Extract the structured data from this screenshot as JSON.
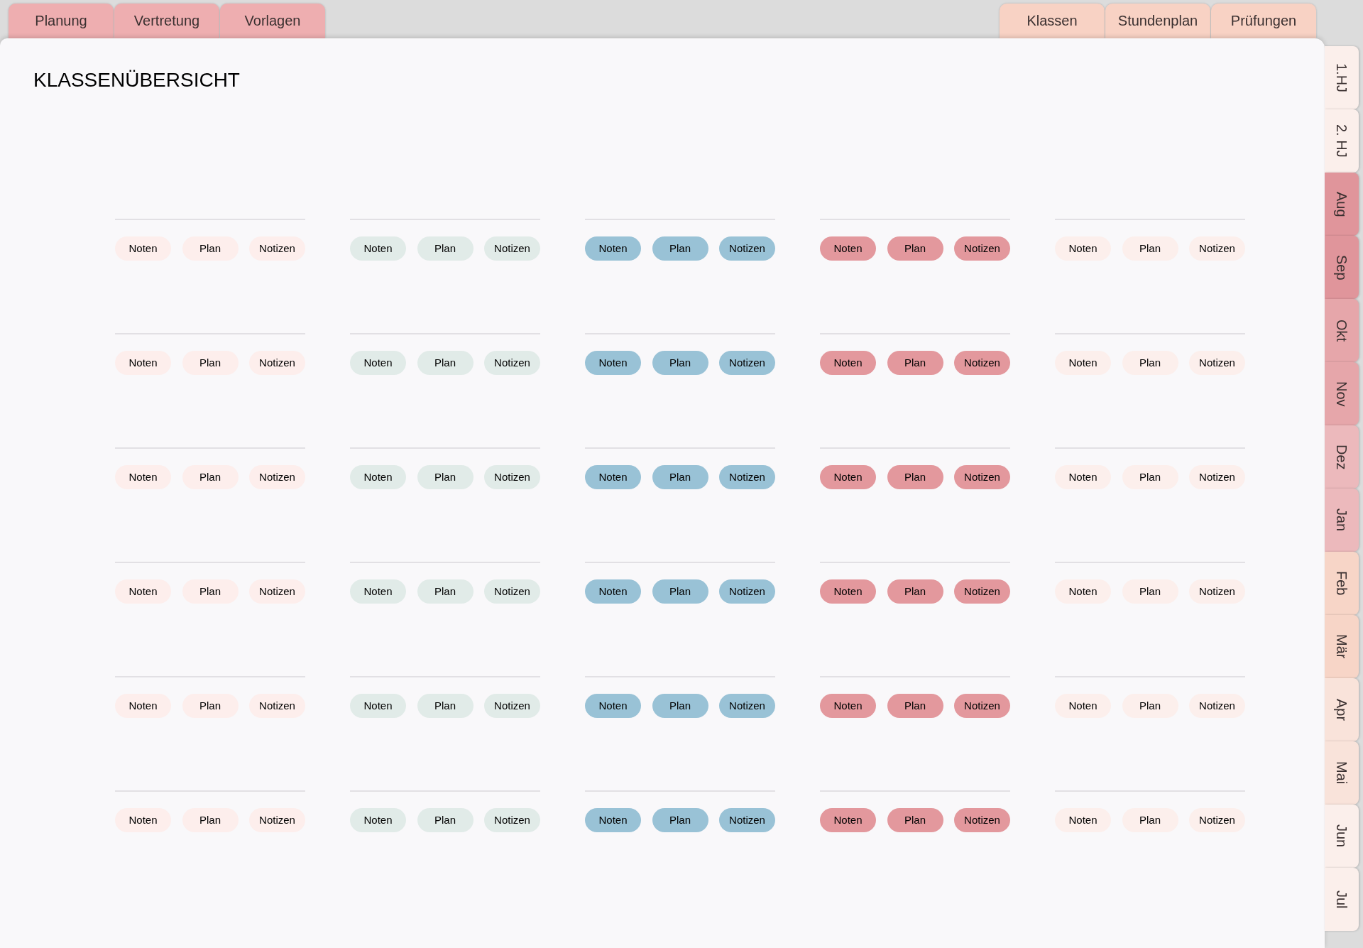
{
  "top_tabs_left": [
    {
      "label": "Planung",
      "color": "#eeaeb0"
    },
    {
      "label": "Vertretung",
      "color": "#eeaeb0"
    },
    {
      "label": "Vorlagen",
      "color": "#eeaeb0"
    }
  ],
  "top_tabs_right": [
    {
      "label": "Klassen",
      "color": "#f8d2c4"
    },
    {
      "label": "Stundenplan",
      "color": "#f8d2c4"
    },
    {
      "label": "Prüfungen",
      "color": "#f8d2c4"
    }
  ],
  "title": "KLASSENÜBERSICHT",
  "side_tabs": [
    {
      "label": "1.HJ",
      "color": "#fbefeb"
    },
    {
      "label": "2. HJ",
      "color": "#fbefeb"
    },
    {
      "label": "Aug",
      "color": "#e0959b"
    },
    {
      "label": "Sep",
      "color": "#e0959b"
    },
    {
      "label": "Okt",
      "color": "#e6a6aa"
    },
    {
      "label": "Nov",
      "color": "#e6a6aa"
    },
    {
      "label": "Dez",
      "color": "#ecb9bc"
    },
    {
      "label": "Jan",
      "color": "#ecb9bc"
    },
    {
      "label": "Feb",
      "color": "#f7d5c7"
    },
    {
      "label": "Mär",
      "color": "#f7d5c7"
    },
    {
      "label": "Apr",
      "color": "#f9e3da"
    },
    {
      "label": "Mai",
      "color": "#f9e3da"
    },
    {
      "label": "Jun",
      "color": "#fbefeb"
    },
    {
      "label": "Jul",
      "color": "#fbefeb"
    }
  ],
  "class_columns": [
    {
      "color": "#fdeeec",
      "cards": [
        [
          "Noten",
          "Plan",
          "Notizen"
        ],
        [
          "Noten",
          "Plan",
          "Notizen"
        ],
        [
          "Noten",
          "Plan",
          "Notizen"
        ],
        [
          "Noten",
          "Plan",
          "Notizen"
        ],
        [
          "Noten",
          "Plan",
          "Notizen"
        ],
        [
          "Noten",
          "Plan",
          "Notizen"
        ]
      ]
    },
    {
      "color": "#e1ebe8",
      "cards": [
        [
          "Noten",
          "Plan",
          "Notizen"
        ],
        [
          "Noten",
          "Plan",
          "Notizen"
        ],
        [
          "Noten",
          "Plan",
          "Notizen"
        ],
        [
          "Noten",
          "Plan",
          "Notizen"
        ],
        [
          "Noten",
          "Plan",
          "Notizen"
        ],
        [
          "Noten",
          "Plan",
          "Notizen"
        ]
      ]
    },
    {
      "color": "#99c2d6",
      "cards": [
        [
          "Noten",
          "Plan",
          "Notizen"
        ],
        [
          "Noten",
          "Plan",
          "Notizen"
        ],
        [
          "Noten",
          "Plan",
          "Notizen"
        ],
        [
          "Noten",
          "Plan",
          "Notizen"
        ],
        [
          "Noten",
          "Plan",
          "Notizen"
        ],
        [
          "Noten",
          "Plan",
          "Notizen"
        ]
      ]
    },
    {
      "color": "#e3989d",
      "cards": [
        [
          "Noten",
          "Plan",
          "Notizen"
        ],
        [
          "Noten",
          "Plan",
          "Notizen"
        ],
        [
          "Noten",
          "Plan",
          "Notizen"
        ],
        [
          "Noten",
          "Plan",
          "Notizen"
        ],
        [
          "Noten",
          "Plan",
          "Notizen"
        ],
        [
          "Noten",
          "Plan",
          "Notizen"
        ]
      ]
    },
    {
      "color": "#fcefec",
      "cards": [
        [
          "Noten",
          "Plan",
          "Notizen"
        ],
        [
          "Noten",
          "Plan",
          "Notizen"
        ],
        [
          "Noten",
          "Plan",
          "Notizen"
        ],
        [
          "Noten",
          "Plan",
          "Notizen"
        ],
        [
          "Noten",
          "Plan",
          "Notizen"
        ],
        [
          "Noten",
          "Plan",
          "Notizen"
        ]
      ]
    }
  ]
}
